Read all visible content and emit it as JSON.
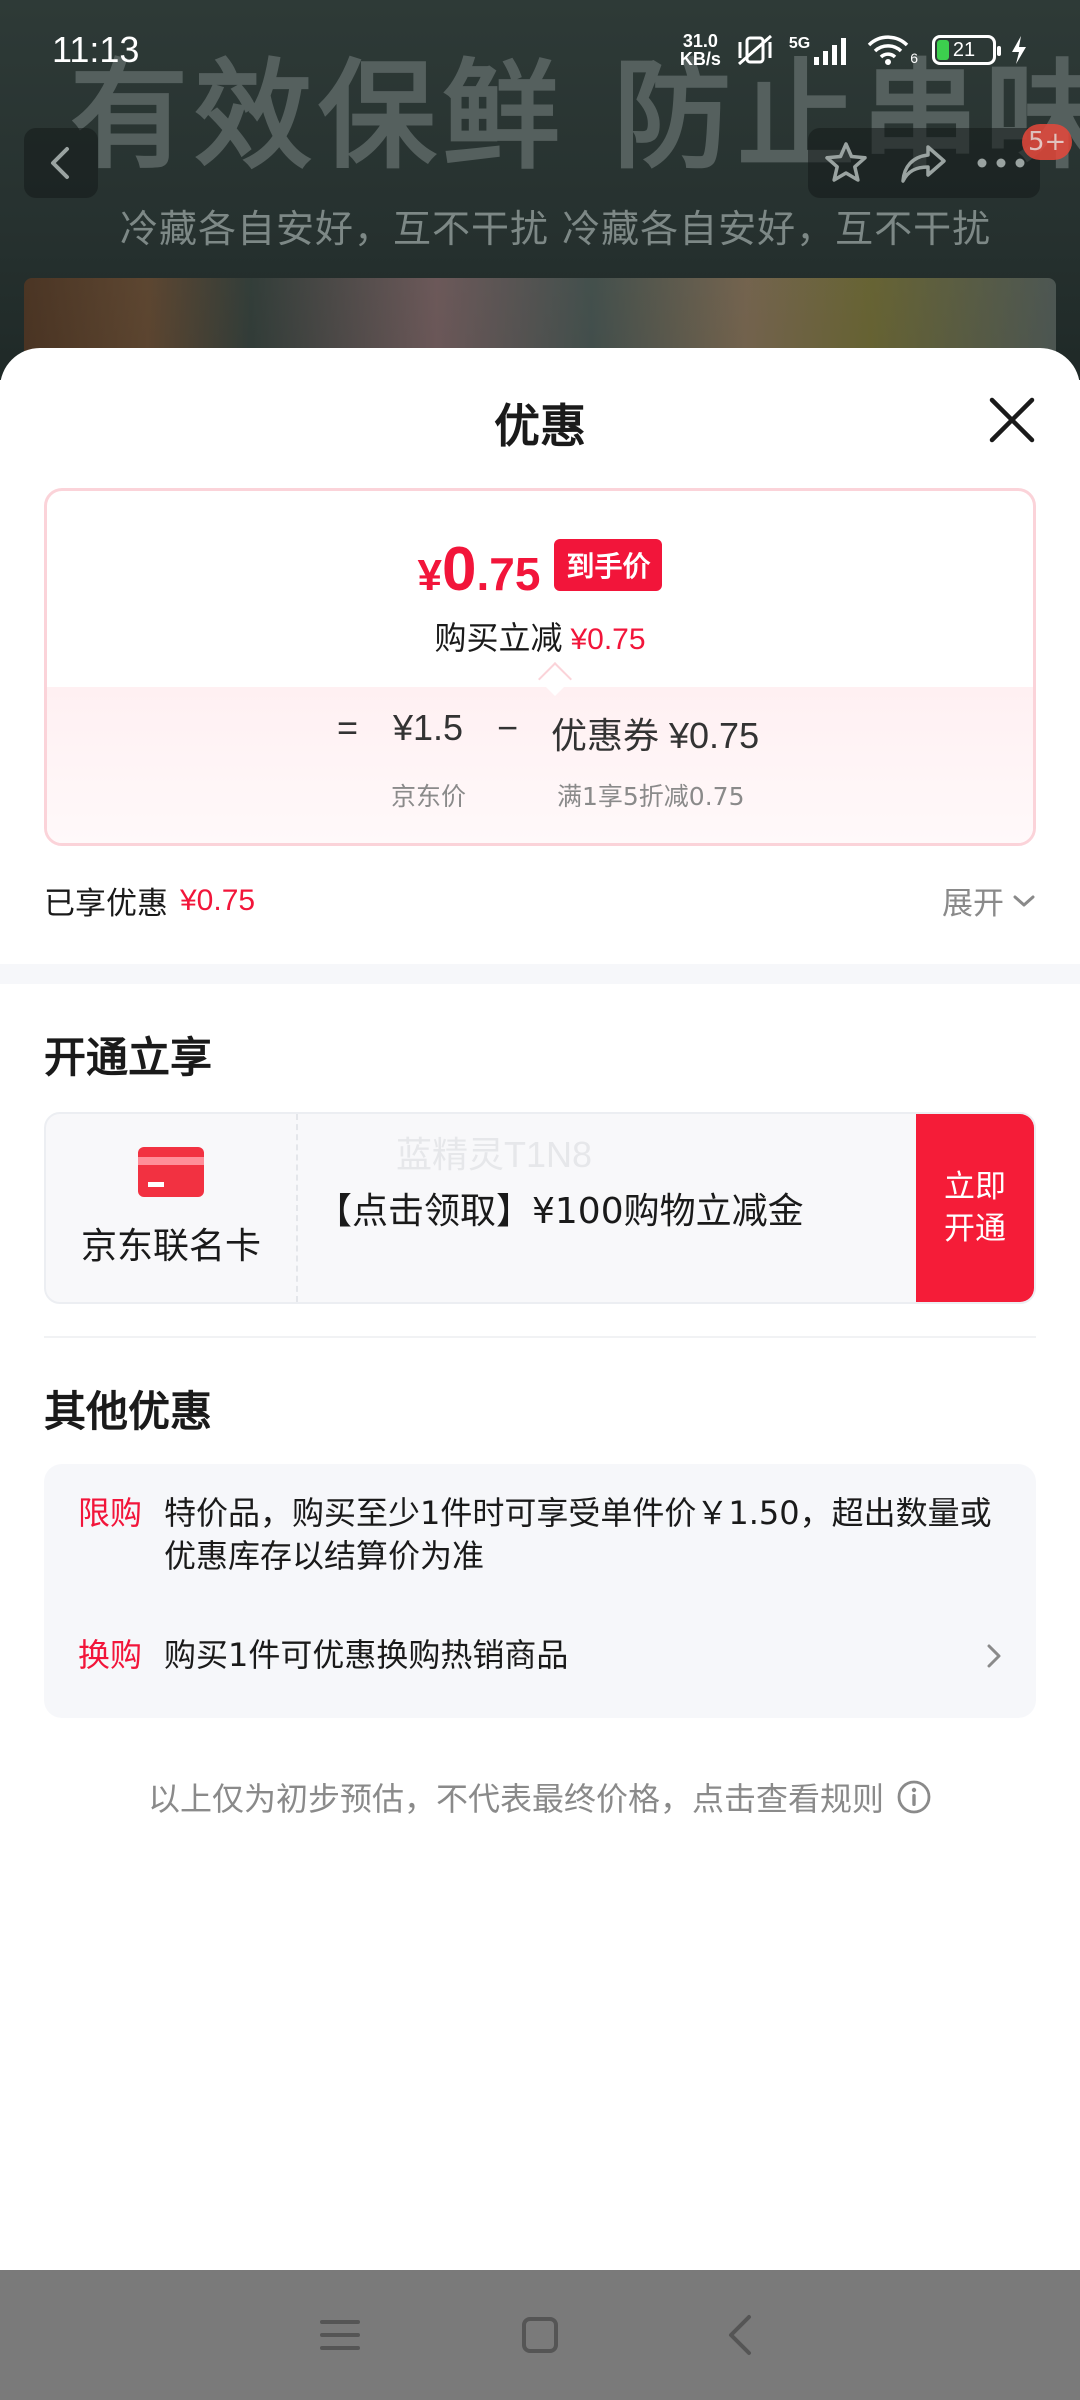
{
  "status_bar": {
    "time": "11:13",
    "net_speed_value": "31.0",
    "net_speed_unit": "KB/s",
    "network_type": "5G",
    "wifi_label": "6",
    "battery_level": "21",
    "battery_fraction": 0.21
  },
  "background_page": {
    "headline": "有效保鲜 防止串味",
    "subline": "冷藏各自安好，互不干扰 冷藏各自安好，互不干扰",
    "cart_badge": "5+"
  },
  "sheet": {
    "title": "优惠",
    "price_card": {
      "final_currency": "¥",
      "final_int": "0",
      "final_dec": ".75",
      "final_tag": "到手价",
      "instant_label": "购买立减",
      "instant_value": "¥0.75",
      "equals": "=",
      "jd_price": "¥1.5",
      "jd_price_label": "京东价",
      "minus": "−",
      "coupon": "优惠券 ¥0.75",
      "coupon_desc": "满1享5折减0.75"
    },
    "enjoyed_label": "已享优惠",
    "enjoyed_value": "¥0.75",
    "expand_label": "展开",
    "open_section_title": "开通立享",
    "card_offer": {
      "name": "京东联名卡",
      "desc": "【点击领取】¥100购物立减金",
      "watermark": "蓝精灵T1N8",
      "button": "立即开通"
    },
    "other_section_title": "其他优惠",
    "other_offers": [
      {
        "tag": "限购",
        "text": "特价品，购买至少1件时可享受单件价￥1.50，超出数量或优惠库存以结算价为准"
      },
      {
        "tag": "换购",
        "text": "购买1件可优惠换购热销商品"
      }
    ],
    "footer_note": "以上仅为初步预估，不代表最终价格，点击查看规则"
  },
  "colors": {
    "accent_red": "#f2153a",
    "card_border": "#fbd3d9",
    "muted_text": "#8a8a8a"
  }
}
